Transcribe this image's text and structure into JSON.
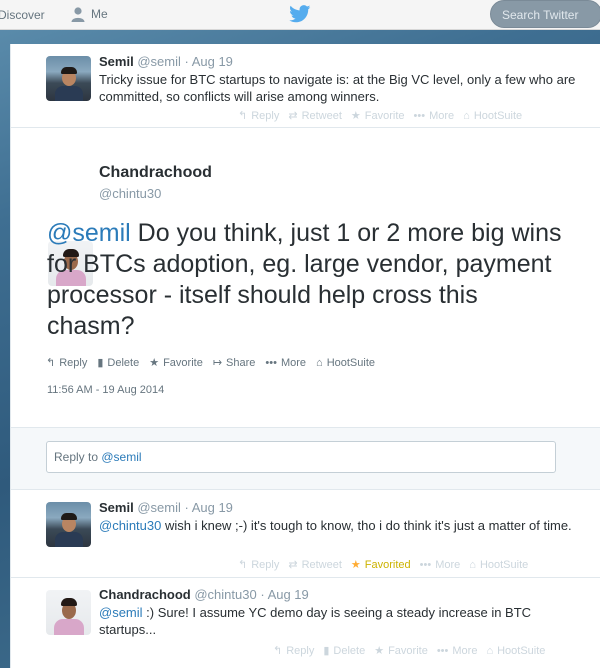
{
  "topbar": {
    "discover": "Discover",
    "me": "Me",
    "search_placeholder": "Search Twitter"
  },
  "tweets": [
    {
      "name": "Semil",
      "handle": "@semil",
      "time": "· Aug 19",
      "text": "Tricky issue for BTC startups to navigate is: at the Big VC level, only a few who are committed, so conflicts will arise among winners.",
      "actions": [
        "Reply",
        "Retweet",
        "Favorite",
        "More",
        "HootSuite"
      ]
    }
  ],
  "focused": {
    "name": "Chandrachood",
    "handle": "@chintu30",
    "mention": "@semil",
    "text": " Do you think, just 1 or 2 more big wins for BTCs adoption, eg. large vendor, payment processor - itself should help cross this chasm?",
    "actions": [
      "Reply",
      "Delete",
      "Favorite",
      "Share",
      "More",
      "HootSuite"
    ],
    "timestamp": "11:56 AM - 19 Aug 2014"
  },
  "reply_box": {
    "prefix": "Reply to ",
    "mention": "@semil"
  },
  "replies": [
    {
      "name": "Semil",
      "handle": "@semil",
      "time": "· Aug 19",
      "mention": "@chintu30",
      "text": " wish i knew ;-) it's tough to know, tho i do think it's just a matter of time.",
      "actions": [
        "Reply",
        "Retweet",
        "Favorited",
        "More",
        "HootSuite"
      ]
    },
    {
      "name": "Chandrachood",
      "handle": "@chintu30",
      "time": "· Aug 19",
      "mention": "@semil",
      "text": " :) Sure! I assume YC demo day is seeing a steady increase in BTC startups...",
      "actions": [
        "Reply",
        "Delete",
        "Favorite",
        "More",
        "HootSuite"
      ]
    }
  ],
  "colors": {
    "link": "#2b7bb9",
    "favorited": "#ffac33"
  }
}
